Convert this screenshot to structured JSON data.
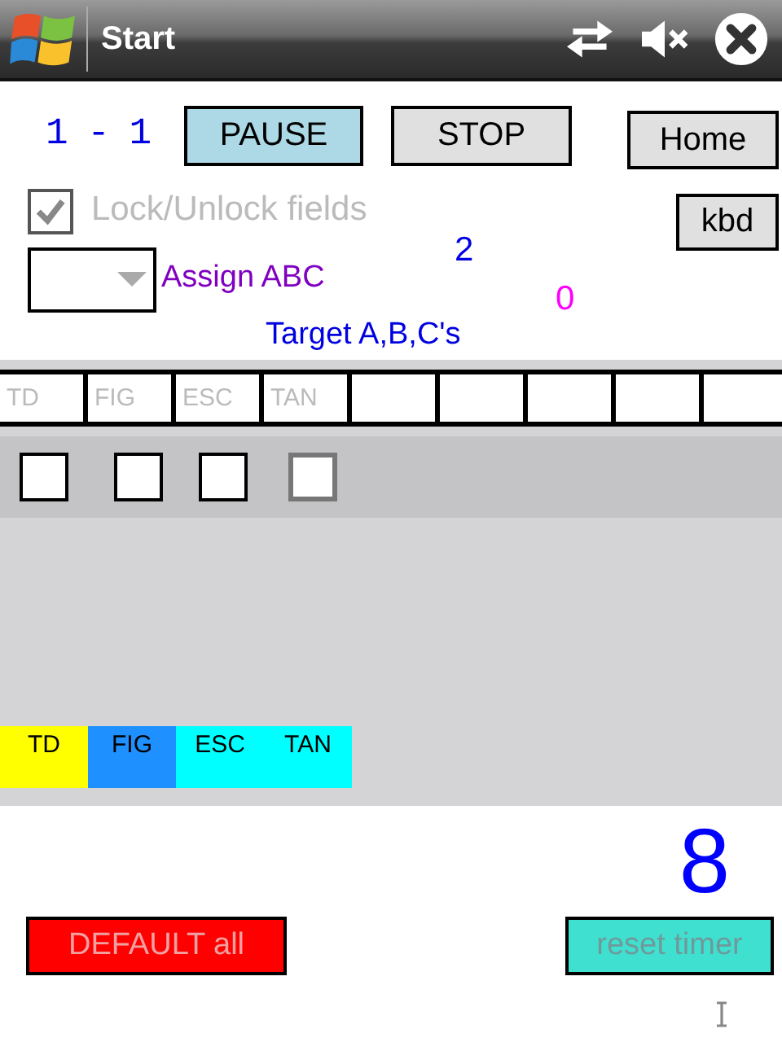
{
  "title_bar": {
    "title": "Start"
  },
  "counter": "1 - 1",
  "top_buttons": [
    {
      "label": "PAUSE",
      "color": "#add8e6"
    },
    {
      "label": "STOP",
      "color": "#e0e0e0"
    },
    {
      "label": "Home",
      "color": "#e0e0e0"
    }
  ],
  "lock_checkbox": {
    "label": "Lock/Unlock fields",
    "checked": true,
    "disabled": true
  },
  "kbd_button": {
    "label": "kbd"
  },
  "count_a": "2",
  "assign_dropdown": {
    "label": "Assign ABC"
  },
  "count_b": "0",
  "target_label": "Target A,B,C's",
  "fields": [
    {
      "kind": "labeled",
      "placeholder": "TD"
    },
    {
      "kind": "labeled",
      "placeholder": "FIG"
    },
    {
      "kind": "labeled",
      "placeholder": "ESC"
    },
    {
      "kind": "labeled",
      "placeholder": "TAN"
    },
    {
      "kind": "blank"
    },
    {
      "kind": "blank"
    },
    {
      "kind": "blank"
    },
    {
      "kind": "blank"
    },
    {
      "kind": "blank"
    }
  ],
  "checkboxes": [
    {
      "checked": false,
      "disabled": false
    },
    {
      "checked": false,
      "disabled": false
    },
    {
      "checked": false,
      "disabled": false
    },
    {
      "checked": false,
      "disabled": true
    }
  ],
  "legend": [
    {
      "label": "TD",
      "color": "#ffff00"
    },
    {
      "label": "FIG",
      "color": "#1e90ff"
    },
    {
      "label": "ESC",
      "color": "#00ffff"
    },
    {
      "label": "TAN",
      "color": "#00ffff"
    }
  ],
  "timer": "8",
  "default_button": {
    "label": "DEFAULT all",
    "disabled": true
  },
  "reset_button": {
    "label": "reset timer",
    "disabled": true
  }
}
